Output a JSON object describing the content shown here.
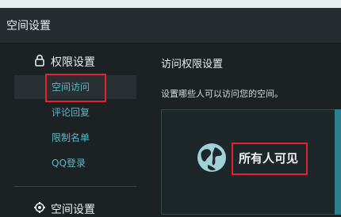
{
  "window": {
    "title": "空间设置"
  },
  "sidebar": {
    "group1": {
      "icon": "lock-icon",
      "label": "权限设置"
    },
    "items": [
      {
        "label": "空间访问",
        "active": true
      },
      {
        "label": "评论回复"
      },
      {
        "label": "限制名单"
      },
      {
        "label": "QQ登录"
      }
    ],
    "group2": {
      "icon": "gear-icon",
      "label": "空间设置"
    }
  },
  "main": {
    "title": "访问权限设置",
    "description": "设置哪些人可以访问您的空间。",
    "option": {
      "icon": "globe-icon",
      "label": "所有人可见"
    }
  },
  "colors": {
    "accent": "#5fb6c4",
    "highlight": "#e4232e",
    "panel_side": "#2e7f8e"
  }
}
